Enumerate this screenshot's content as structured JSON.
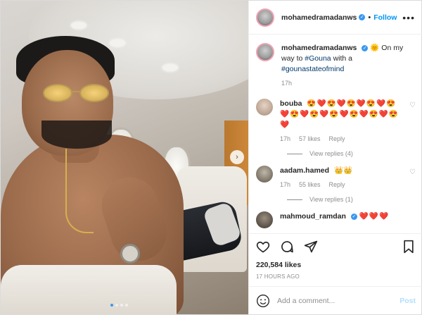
{
  "header": {
    "username": "mohamedramadanws",
    "follow_label": "Follow",
    "more_icon": "more-options-icon"
  },
  "caption": {
    "username": "mohamedramadanws",
    "sun_emoji": "🌞",
    "text_before": "On my way to",
    "hashtag1": "#Gouna",
    "text_middle": "with a",
    "hashtag2": "#gounastateofmind",
    "time": "17h"
  },
  "comments": [
    {
      "username": "bouba",
      "emojis": "😍❤️😍❤️😍❤️😍❤️😍❤️😍❤️😍❤️😍❤️😍❤️😍❤️😍❤️",
      "time": "17h",
      "likes": "57 likes",
      "reply": "Reply",
      "view_replies": "View replies (4)"
    },
    {
      "username": "aadam.hamed",
      "emojis": "👑👑",
      "time": "17h",
      "likes": "55 likes",
      "reply": "Reply",
      "view_replies": "View replies (1)"
    },
    {
      "username": "mahmoud_ramdan",
      "emojis": "❤️❤️❤️"
    }
  ],
  "actions": {
    "likes_count": "220,584 likes",
    "time_ago": "17 HOURS AGO"
  },
  "add_comment": {
    "placeholder": "Add a comment...",
    "post_label": "Post"
  },
  "carousel": {
    "current": 1,
    "total": 4
  },
  "colors": {
    "accent": "#0095f6",
    "verified": "#3897f0",
    "heart": "#ed4956"
  }
}
